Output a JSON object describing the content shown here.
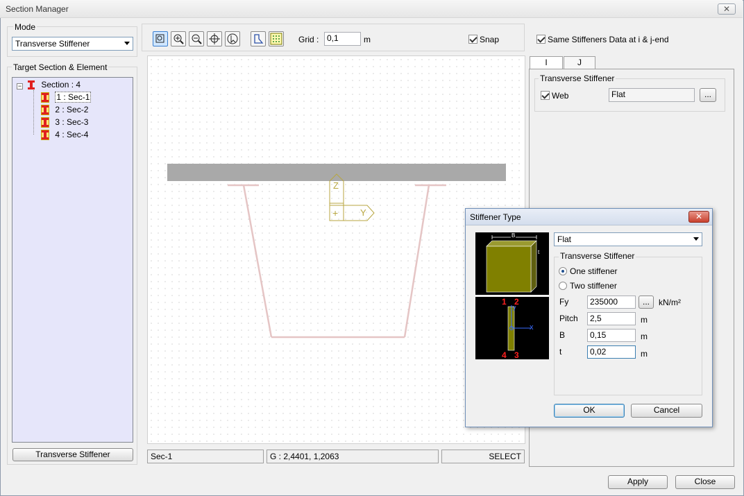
{
  "window": {
    "title": "Section Manager",
    "close_glyph": "✕"
  },
  "left": {
    "mode_label": "Mode",
    "mode_value": "Transverse Stiffener",
    "target_label": "Target Section & Element",
    "tree": {
      "root": "Section : 4",
      "items": [
        "1 : Sec-1",
        "2 : Sec-2",
        "3 : Sec-3",
        "4 : Sec-4"
      ]
    },
    "bottom_button": "Transverse Stiffener"
  },
  "toolbar": {
    "grid_label": "Grid :",
    "grid_value": "0,1",
    "grid_unit": "m",
    "snap_label": "Snap",
    "snap_checked": true
  },
  "axes": {
    "z": "Z",
    "y": "Y",
    "origin": "+"
  },
  "statusbar": {
    "section": "Sec-1",
    "coords": "G : 2,4401, 1,2063",
    "mode": "SELECT"
  },
  "right": {
    "same_data_label": "Same Stiffeners Data at i & j-end",
    "same_data_checked": true,
    "tabs": [
      "I",
      "J"
    ],
    "active_tab": "I",
    "group_label": "Transverse Stiffener",
    "web_label": "Web",
    "web_checked": true,
    "web_value": "Flat",
    "browse_label": "..."
  },
  "dialog": {
    "title": "Stiffener Type",
    "close_glyph": "✕",
    "type_value": "Flat",
    "group_label": "Transverse Stiffener",
    "radio_one": "One stiffener",
    "radio_two": "Two stiffener",
    "radio_selected": "one",
    "fields": [
      {
        "label": "Fy",
        "value": "235000",
        "unit": "kN/m²",
        "has_browse": true
      },
      {
        "label": "Pitch",
        "value": "2,5",
        "unit": "m"
      },
      {
        "label": "B",
        "value": "0,15",
        "unit": "m"
      },
      {
        "label": "t",
        "value": "0,02",
        "unit": "m"
      }
    ],
    "browse_label": "...",
    "ok_label": "OK",
    "cancel_label": "Cancel",
    "preview": {
      "b_label": "B",
      "t_label": "t",
      "points": [
        "1",
        "2",
        "4",
        "3"
      ],
      "y_axis": "y",
      "x_axis": "x"
    }
  },
  "footer": {
    "apply": "Apply",
    "close": "Close"
  },
  "colors": {
    "stiffener_fill": "#808000",
    "tree_bg": "#e6e6fa",
    "deck": "#a9a9a9",
    "web_line": "#e5c5c5",
    "axis": "#b8a640"
  }
}
